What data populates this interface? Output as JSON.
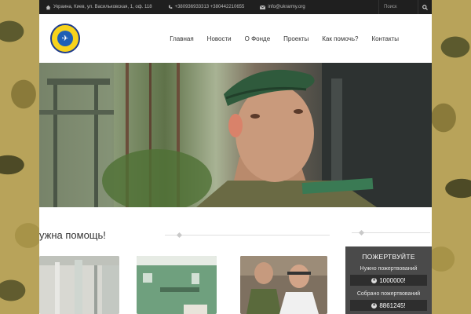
{
  "topbar": {
    "address": "Украина, Киев, ул. Васильковская, 1, оф. 118",
    "phones": "+380936933313 +380442210655",
    "email": "info@ukrarmy.org",
    "search_placeholder": "Поиск"
  },
  "logo": {
    "alt_text": "ПІДТРИМАЙ АРМІЮ УКРАЇНИ"
  },
  "nav": {
    "items": [
      "Главная",
      "Новости",
      "О Фонде",
      "Проекты",
      "Как помочь?",
      "Контакты"
    ]
  },
  "main": {
    "help_title": "ужна помощь!"
  },
  "donate": {
    "title": "ПОЖЕРТВУЙТЕ",
    "needed_label": "Нужно пожертвований",
    "needed_amount": "1000000!",
    "collected_label": "Собрано пожертвований",
    "collected_amount": "8861245!"
  },
  "colors": {
    "topbar_bg": "#1f1f1f",
    "donate_bg": "#4a4a4a",
    "logo_yellow": "#f7d31c",
    "logo_blue": "#1e5fb5"
  }
}
